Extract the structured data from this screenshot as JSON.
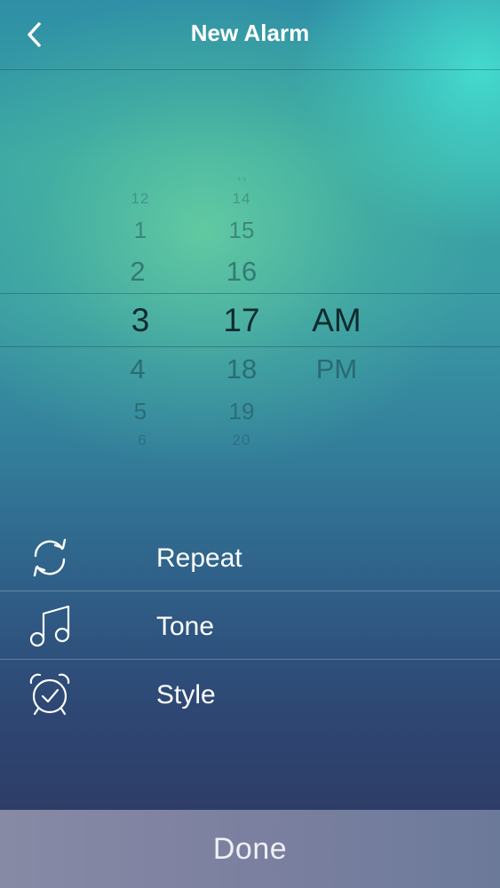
{
  "header": {
    "title": "New Alarm",
    "back_icon": "chevron-left-icon"
  },
  "picker": {
    "hours": [
      "12",
      "1",
      "2",
      "3",
      "4",
      "5",
      "6"
    ],
    "minutes": [
      "13",
      "14",
      "15",
      "16",
      "17",
      "18",
      "19",
      "20"
    ],
    "periods": [
      "AM",
      "PM"
    ],
    "selected": {
      "hour": "3",
      "minute": "17",
      "period": "AM"
    }
  },
  "settings": {
    "items": [
      {
        "label": "Repeat",
        "icon": "repeat-icon"
      },
      {
        "label": "Tone",
        "icon": "music-note-icon"
      },
      {
        "label": "Style",
        "icon": "alarm-clock-icon"
      }
    ]
  },
  "footer": {
    "done_label": "Done"
  }
}
